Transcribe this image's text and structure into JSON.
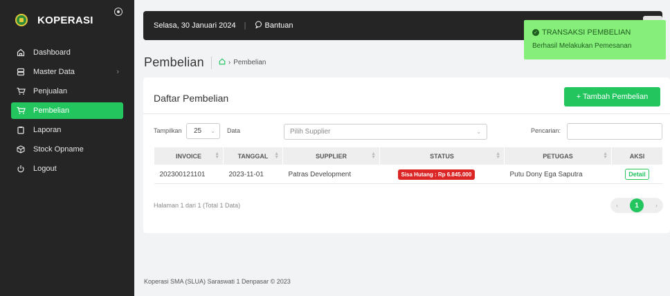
{
  "app": {
    "name": "KOPERASI"
  },
  "sidebar": {
    "items": [
      {
        "label": "Dashboard",
        "icon": "home-icon"
      },
      {
        "label": "Master Data",
        "icon": "database-icon"
      },
      {
        "label": "Penjualan",
        "icon": "cart-icon"
      },
      {
        "label": "Pembelian",
        "icon": "cart-icon",
        "active": true
      },
      {
        "label": "Laporan",
        "icon": "clipboard-icon"
      },
      {
        "label": "Stock Opname",
        "icon": "box-icon"
      },
      {
        "label": "Logout",
        "icon": "power-icon"
      }
    ]
  },
  "topbar": {
    "date": "Selasa, 30 Januari 2024",
    "help": "Bantuan"
  },
  "page": {
    "title": "Pembelian",
    "breadcrumb": "Pembelian"
  },
  "card": {
    "title": "Daftar Pembelian",
    "add_button": "+ Tambah Pembelian",
    "show_label": "Tampilkan",
    "show_value": "25",
    "data_label": "Data",
    "supplier_placeholder": "Pilih Supplier",
    "search_label": "Pencarian:"
  },
  "table": {
    "headers": [
      "INVOICE",
      "TANGGAL",
      "SUPPLIER",
      "STATUS",
      "PETUGAS",
      "AKSI"
    ],
    "rows": [
      {
        "invoice": "202300121101",
        "tanggal": "2023-11-01",
        "supplier": "Patras Development",
        "status": "Sisa Hutang : Rp 6.845.000",
        "petugas": "Putu Dony Ega Saputra",
        "aksi": "Detail"
      }
    ]
  },
  "pagination": {
    "info": "Halaman 1 dari 1 (Total 1 Data)",
    "prev": "‹",
    "current": "1",
    "next": "›"
  },
  "footer": {
    "text": "Koperasi SMA (SLUA) Saraswati 1 Denpasar © 2023"
  },
  "toast": {
    "title": "TRANSAKSI PEMBELIAN",
    "message": "Berhasil Melakukan Pemesanan"
  },
  "colors": {
    "accent": "#22c55e",
    "sidebar": "#252525",
    "danger": "#dc2626",
    "toast": "#86ef7a"
  }
}
